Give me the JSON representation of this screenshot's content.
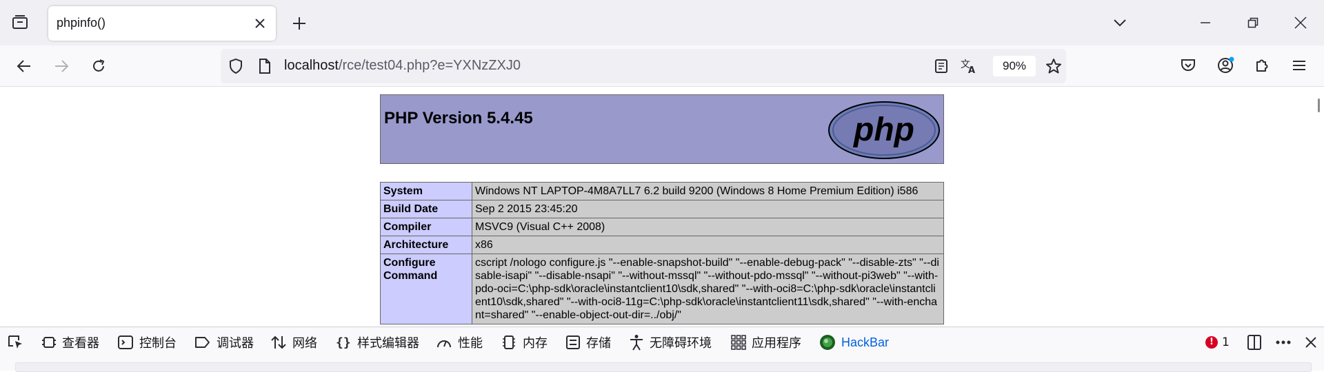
{
  "browser": {
    "tab_title": "phpinfo()",
    "url_host": "localhost",
    "url_path": "/rce/test04.php?e=YXNzZXJ0",
    "zoom": "90%"
  },
  "page": {
    "php_version": "PHP Version 5.4.45",
    "logo_text": "php",
    "rows": [
      {
        "key": "System",
        "value": "Windows NT LAPTOP-4M8A7LL7 6.2 build 9200 (Windows 8 Home Premium Edition) i586"
      },
      {
        "key": "Build Date",
        "value": "Sep 2 2015 23:45:20"
      },
      {
        "key": "Compiler",
        "value": "MSVC9 (Visual C++ 2008)"
      },
      {
        "key": "Architecture",
        "value": "x86"
      },
      {
        "key": "Configure Command",
        "value": "cscript /nologo configure.js \"--enable-snapshot-build\" \"--enable-debug-pack\" \"--disable-zts\" \"--disable-isapi\" \"--disable-nsapi\" \"--without-mssql\" \"--without-pdo-mssql\" \"--without-pi3web\" \"--with-pdo-oci=C:\\php-sdk\\oracle\\instantclient10\\sdk,shared\" \"--with-oci8=C:\\php-sdk\\oracle\\instantclient10\\sdk,shared\" \"--with-oci8-11g=C:\\php-sdk\\oracle\\instantclient11\\sdk,shared\" \"--with-enchant=shared\" \"--enable-object-out-dir=../obj/\""
      }
    ]
  },
  "devtools": {
    "tabs": [
      "查看器",
      "控制台",
      "调试器",
      "网络",
      "样式编辑器",
      "性能",
      "内存",
      "存储",
      "无障碍环境",
      "应用程序",
      "HackBar"
    ],
    "error_count": "1"
  },
  "colors": {
    "php_header_bg": "#9999cc",
    "row_key_bg": "#ccccff",
    "row_value_bg": "#cccccc",
    "hackbar_link": "#0060df",
    "error_badge": "#d70022"
  }
}
